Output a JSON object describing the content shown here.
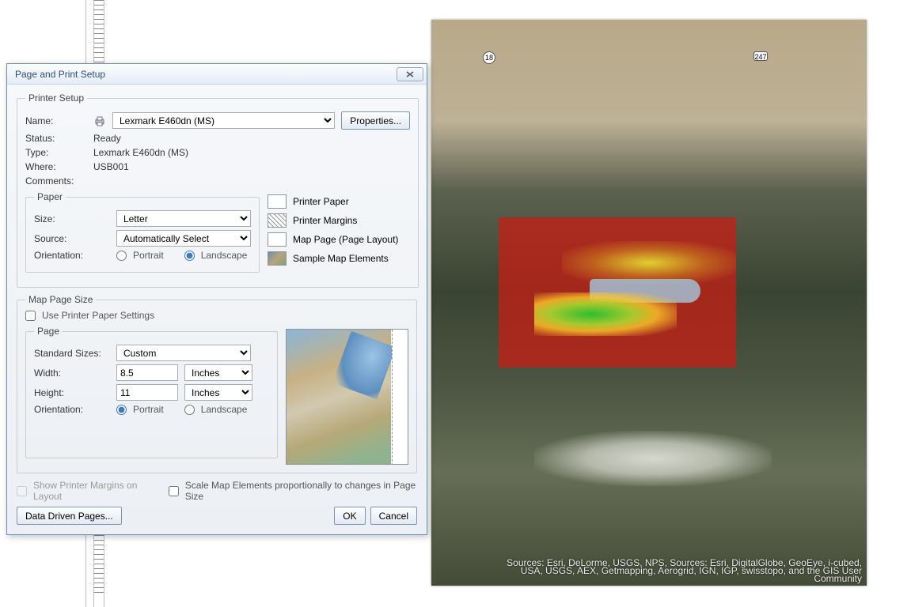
{
  "dialog": {
    "title": "Page and Print Setup",
    "printerSetup": {
      "legend": "Printer Setup",
      "nameLabel": "Name:",
      "nameValue": "Lexmark E460dn (MS)",
      "propertiesBtn": "Properties...",
      "statusLabel": "Status:",
      "statusValue": "Ready",
      "typeLabel": "Type:",
      "typeValue": "Lexmark E460dn (MS)",
      "whereLabel": "Where:",
      "whereValue": "USB001",
      "commentsLabel": "Comments:"
    },
    "paper": {
      "legend": "Paper",
      "sizeLabel": "Size:",
      "sizeValue": "Letter",
      "sourceLabel": "Source:",
      "sourceValue": "Automatically Select",
      "orientationLabel": "Orientation:",
      "portrait": "Portrait",
      "landscape": "Landscape"
    },
    "legendPanel": {
      "printerPaper": "Printer Paper",
      "printerMargins": "Printer Margins",
      "mapPage": "Map Page (Page Layout)",
      "sampleMap": "Sample Map Elements"
    },
    "mapPageSize": {
      "legend": "Map Page Size",
      "usePrinter": "Use Printer Paper Settings",
      "pageLegend": "Page",
      "standardSizesLabel": "Standard Sizes:",
      "standardSizesValue": "Custom",
      "widthLabel": "Width:",
      "widthValue": "8.5",
      "widthUnit": "Inches",
      "heightLabel": "Height:",
      "heightValue": "11",
      "heightUnit": "Inches",
      "orientationLabel": "Orientation:",
      "portrait": "Portrait",
      "landscape": "Landscape"
    },
    "footer": {
      "showMargins": "Show Printer Margins on Layout",
      "scaleElements": "Scale Map Elements proportionally to changes in Page Size",
      "ddp": "Data Driven Pages...",
      "ok": "OK",
      "cancel": "Cancel"
    }
  },
  "map": {
    "route1": "18",
    "route2": "247",
    "credits1": "Sources: Esri, DeLorme, USGS, NPS, Sources: Esri, DigitalGlobe, GeoEye, i-cubed,",
    "credits2": "USA, USGS, AEX, Getmapping, Aerogrid, IGN, IGP, swisstopo, and the GIS User",
    "credits3": "Community"
  }
}
